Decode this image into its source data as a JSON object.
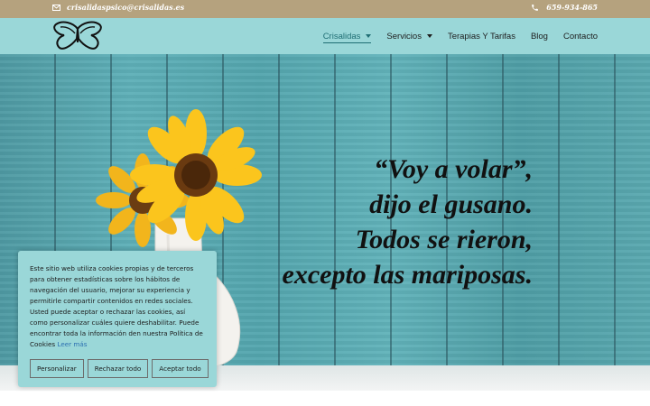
{
  "topbar": {
    "email": "crisalidaspsico@crisalidas.es",
    "phone": "659-934-865"
  },
  "nav": {
    "items": [
      {
        "label": "Crisalidas",
        "has_dropdown": true,
        "active": true
      },
      {
        "label": "Servicios",
        "has_dropdown": true,
        "active": false
      },
      {
        "label": "Terapias Y Tarifas",
        "has_dropdown": false,
        "active": false
      },
      {
        "label": "Blog",
        "has_dropdown": false,
        "active": false
      },
      {
        "label": "Contacto",
        "has_dropdown": false,
        "active": false
      }
    ]
  },
  "hero": {
    "quote_lines": [
      "“Voy a volar”,",
      "dijo el gusano.",
      "Todos se rieron,",
      "excepto las mariposas."
    ]
  },
  "cookie": {
    "text": "Este sitio web utiliza cookies propias y de terceros para obtener estadísticas sobre los hábitos de navegación del usuario, mejorar su experiencia y permitirle compartir contenidos en redes sociales. Usted puede aceptar o rechazar las cookies, así como personalizar cuáles quiere deshabilitar. Puede encontrar toda la información den nuestra Política de Cookies",
    "link": "Leer más",
    "buttons": {
      "customize": "Personalizar",
      "reject": "Rechazar todo",
      "accept": "Aceptar todo"
    }
  },
  "colors": {
    "topbar_bg": "#b5a27e",
    "navbar_bg": "#9ad7d8",
    "active_nav": "#1f6e74",
    "link": "#2b6fb1"
  },
  "icons": {
    "email": "envelope-icon",
    "phone": "phone-icon",
    "logo": "butterfly-logo-icon",
    "dropdown": "chevron-down-icon"
  }
}
